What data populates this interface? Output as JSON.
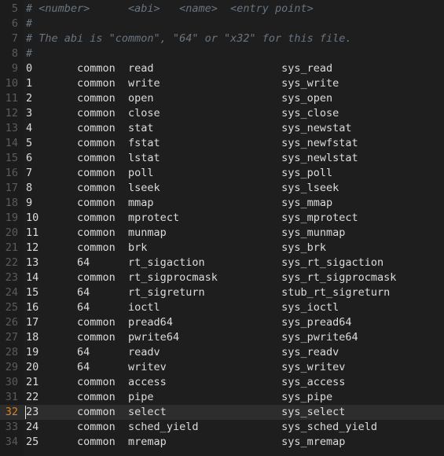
{
  "editor": {
    "theme_colors": {
      "background": "#1e1e1e",
      "gutter_background": "#1c1c1c",
      "code_text": "#dcdcdc",
      "comment_text": "#6a7580",
      "line_number": "#5c5c5c",
      "active_line_number": "#d9842b",
      "active_line_background": "#2d2d2d",
      "caret": "#e8e8e8"
    },
    "tab_size": 8,
    "active_line_number": 32,
    "caret_column": 1,
    "first_visible_line": 5,
    "last_visible_line": 34,
    "lines": [
      {
        "number": "5",
        "text": "# <number>\t<abi>\t<name>\t<entry point>",
        "kind": "comment"
      },
      {
        "number": "6",
        "text": "#",
        "kind": "comment"
      },
      {
        "number": "7",
        "text": "# The abi is \"common\", \"64\" or \"x32\" for this file.",
        "kind": "comment"
      },
      {
        "number": "8",
        "text": "#",
        "kind": "comment"
      },
      {
        "number": "9",
        "text": "0\tcommon\tread\t\t\tsys_read",
        "kind": "code"
      },
      {
        "number": "10",
        "text": "1\tcommon\twrite\t\t\tsys_write",
        "kind": "code"
      },
      {
        "number": "11",
        "text": "2\tcommon\topen\t\t\tsys_open",
        "kind": "code"
      },
      {
        "number": "12",
        "text": "3\tcommon\tclose\t\t\tsys_close",
        "kind": "code"
      },
      {
        "number": "13",
        "text": "4\tcommon\tstat\t\t\tsys_newstat",
        "kind": "code"
      },
      {
        "number": "14",
        "text": "5\tcommon\tfstat\t\t\tsys_newfstat",
        "kind": "code"
      },
      {
        "number": "15",
        "text": "6\tcommon\tlstat\t\t\tsys_newlstat",
        "kind": "code"
      },
      {
        "number": "16",
        "text": "7\tcommon\tpoll\t\t\tsys_poll",
        "kind": "code"
      },
      {
        "number": "17",
        "text": "8\tcommon\tlseek\t\t\tsys_lseek",
        "kind": "code"
      },
      {
        "number": "18",
        "text": "9\tcommon\tmmap\t\t\tsys_mmap",
        "kind": "code"
      },
      {
        "number": "19",
        "text": "10\tcommon\tmprotect\t\tsys_mprotect",
        "kind": "code"
      },
      {
        "number": "20",
        "text": "11\tcommon\tmunmap\t\t\tsys_munmap",
        "kind": "code"
      },
      {
        "number": "21",
        "text": "12\tcommon\tbrk\t\t\tsys_brk",
        "kind": "code"
      },
      {
        "number": "22",
        "text": "13\t64\trt_sigaction\t\tsys_rt_sigaction",
        "kind": "code"
      },
      {
        "number": "23",
        "text": "14\tcommon\trt_sigprocmask\t\tsys_rt_sigprocmask",
        "kind": "code"
      },
      {
        "number": "24",
        "text": "15\t64\trt_sigreturn\t\tstub_rt_sigreturn",
        "kind": "code"
      },
      {
        "number": "25",
        "text": "16\t64\tioctl\t\t\tsys_ioctl",
        "kind": "code"
      },
      {
        "number": "26",
        "text": "17\tcommon\tpread64\t\t\tsys_pread64",
        "kind": "code"
      },
      {
        "number": "27",
        "text": "18\tcommon\tpwrite64\t\tsys_pwrite64",
        "kind": "code"
      },
      {
        "number": "28",
        "text": "19\t64\treadv\t\t\tsys_readv",
        "kind": "code"
      },
      {
        "number": "29",
        "text": "20\t64\twritev\t\t\tsys_writev",
        "kind": "code"
      },
      {
        "number": "30",
        "text": "21\tcommon\taccess\t\t\tsys_access",
        "kind": "code"
      },
      {
        "number": "31",
        "text": "22\tcommon\tpipe\t\t\tsys_pipe",
        "kind": "code"
      },
      {
        "number": "32",
        "text": "23\tcommon\tselect\t\t\tsys_select",
        "kind": "code"
      },
      {
        "number": "33",
        "text": "24\tcommon\tsched_yield\t\tsys_sched_yield",
        "kind": "code"
      },
      {
        "number": "34",
        "text": "25\tcommon\tmremap\t\t\tsys_mremap",
        "kind": "code"
      }
    ]
  }
}
